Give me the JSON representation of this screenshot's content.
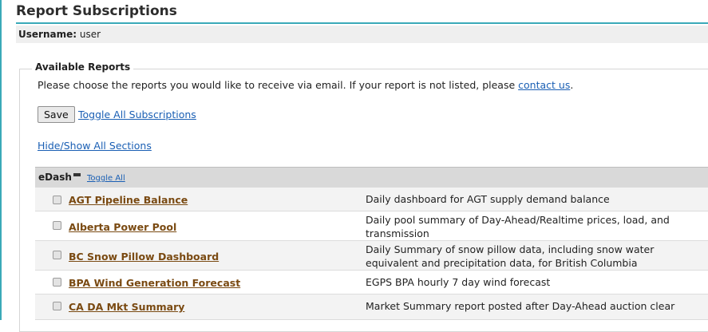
{
  "page": {
    "title": "Report Subscriptions",
    "username_label": "Username:",
    "username_value": "user"
  },
  "available": {
    "legend": "Available Reports",
    "intro_text": "Please choose the reports you would like to receive via email. If your report is not listed, please ",
    "contact_link": "contact us",
    "intro_end": ".",
    "save_label": "Save",
    "toggle_all_subscriptions": "Toggle All Subscriptions",
    "hide_show_sections": "Hide/Show All Sections"
  },
  "section": {
    "name": "eDash",
    "toggle_all": "Toggle All",
    "reports": [
      {
        "title": "AGT Pipeline Balance",
        "description": "Daily dashboard for AGT supply demand balance",
        "checked": false
      },
      {
        "title": "Alberta Power Pool",
        "description": "Daily pool summary of Day-Ahead/Realtime prices, load, and transmission",
        "checked": false
      },
      {
        "title": "BC Snow Pillow Dashboard",
        "description": "Daily Summary of snow pillow data, including snow water equivalent and precipitation data, for British Columbia",
        "checked": false
      },
      {
        "title": "BPA Wind Generation Forecast",
        "description": "EGPS BPA hourly 7 day wind forecast",
        "checked": false
      },
      {
        "title": "CA DA Mkt Summary",
        "description": "Market Summary report posted after Day-Ahead auction clear",
        "checked": false
      }
    ]
  }
}
